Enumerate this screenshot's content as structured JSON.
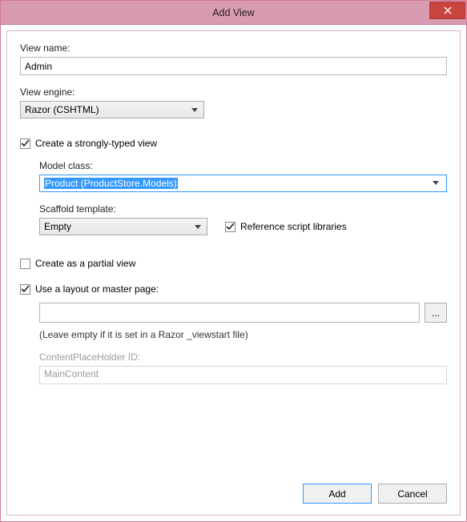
{
  "window": {
    "title": "Add View"
  },
  "viewName": {
    "label": "View name:",
    "value": "Admin"
  },
  "viewEngine": {
    "label": "View engine:",
    "value": "Razor (CSHTML)"
  },
  "stronglyTyped": {
    "label": "Create a strongly-typed view",
    "checked": true
  },
  "modelClass": {
    "label": "Model class:",
    "value": "Product (ProductStore.Models)"
  },
  "scaffold": {
    "label": "Scaffold template:",
    "value": "Empty"
  },
  "referenceScripts": {
    "label": "Reference script libraries",
    "checked": true
  },
  "partialView": {
    "label": "Create as a partial view",
    "checked": false
  },
  "useLayout": {
    "label": "Use a layout or master page:",
    "checked": true,
    "value": "",
    "browseLabel": "...",
    "hint": "(Leave empty if it is set in a Razor _viewstart file)"
  },
  "contentPlaceholder": {
    "label": "ContentPlaceHolder ID:",
    "value": "MainContent"
  },
  "buttons": {
    "add": "Add",
    "cancel": "Cancel"
  }
}
